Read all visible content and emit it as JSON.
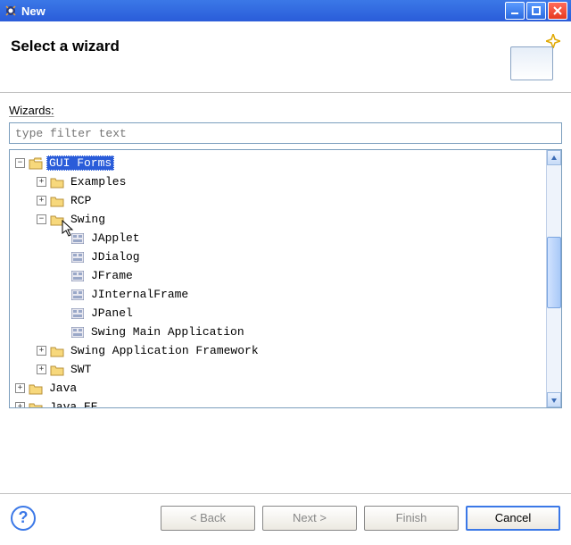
{
  "window": {
    "title": "New"
  },
  "header": {
    "title": "Select a wizard"
  },
  "wizards_label": "Wizards:",
  "filter": {
    "placeholder": "type filter text"
  },
  "tree": {
    "root": {
      "label": "GUI Forms",
      "children": [
        {
          "label": "Examples",
          "icon": "folder",
          "expandable": true,
          "expanded": false
        },
        {
          "label": "RCP",
          "icon": "folder",
          "expandable": true,
          "expanded": false
        },
        {
          "label": "Swing",
          "icon": "folder",
          "expandable": true,
          "expanded": true,
          "children": [
            {
              "label": "JApplet",
              "icon": "form"
            },
            {
              "label": "JDialog",
              "icon": "form"
            },
            {
              "label": "JFrame",
              "icon": "form"
            },
            {
              "label": "JInternalFrame",
              "icon": "form"
            },
            {
              "label": "JPanel",
              "icon": "form"
            },
            {
              "label": "Swing Main Application",
              "icon": "form"
            }
          ]
        },
        {
          "label": "Swing Application Framework",
          "icon": "folder",
          "expandable": true,
          "expanded": false
        },
        {
          "label": "SWT",
          "icon": "folder",
          "expandable": true,
          "expanded": false
        }
      ]
    },
    "siblings": [
      {
        "label": "Java",
        "icon": "folder",
        "expandable": true,
        "expanded": false
      },
      {
        "label": "Java EE",
        "icon": "folder",
        "expandable": true,
        "expanded": false
      }
    ]
  },
  "buttons": {
    "back": "< Back",
    "next": "Next >",
    "finish": "Finish",
    "cancel": "Cancel"
  }
}
